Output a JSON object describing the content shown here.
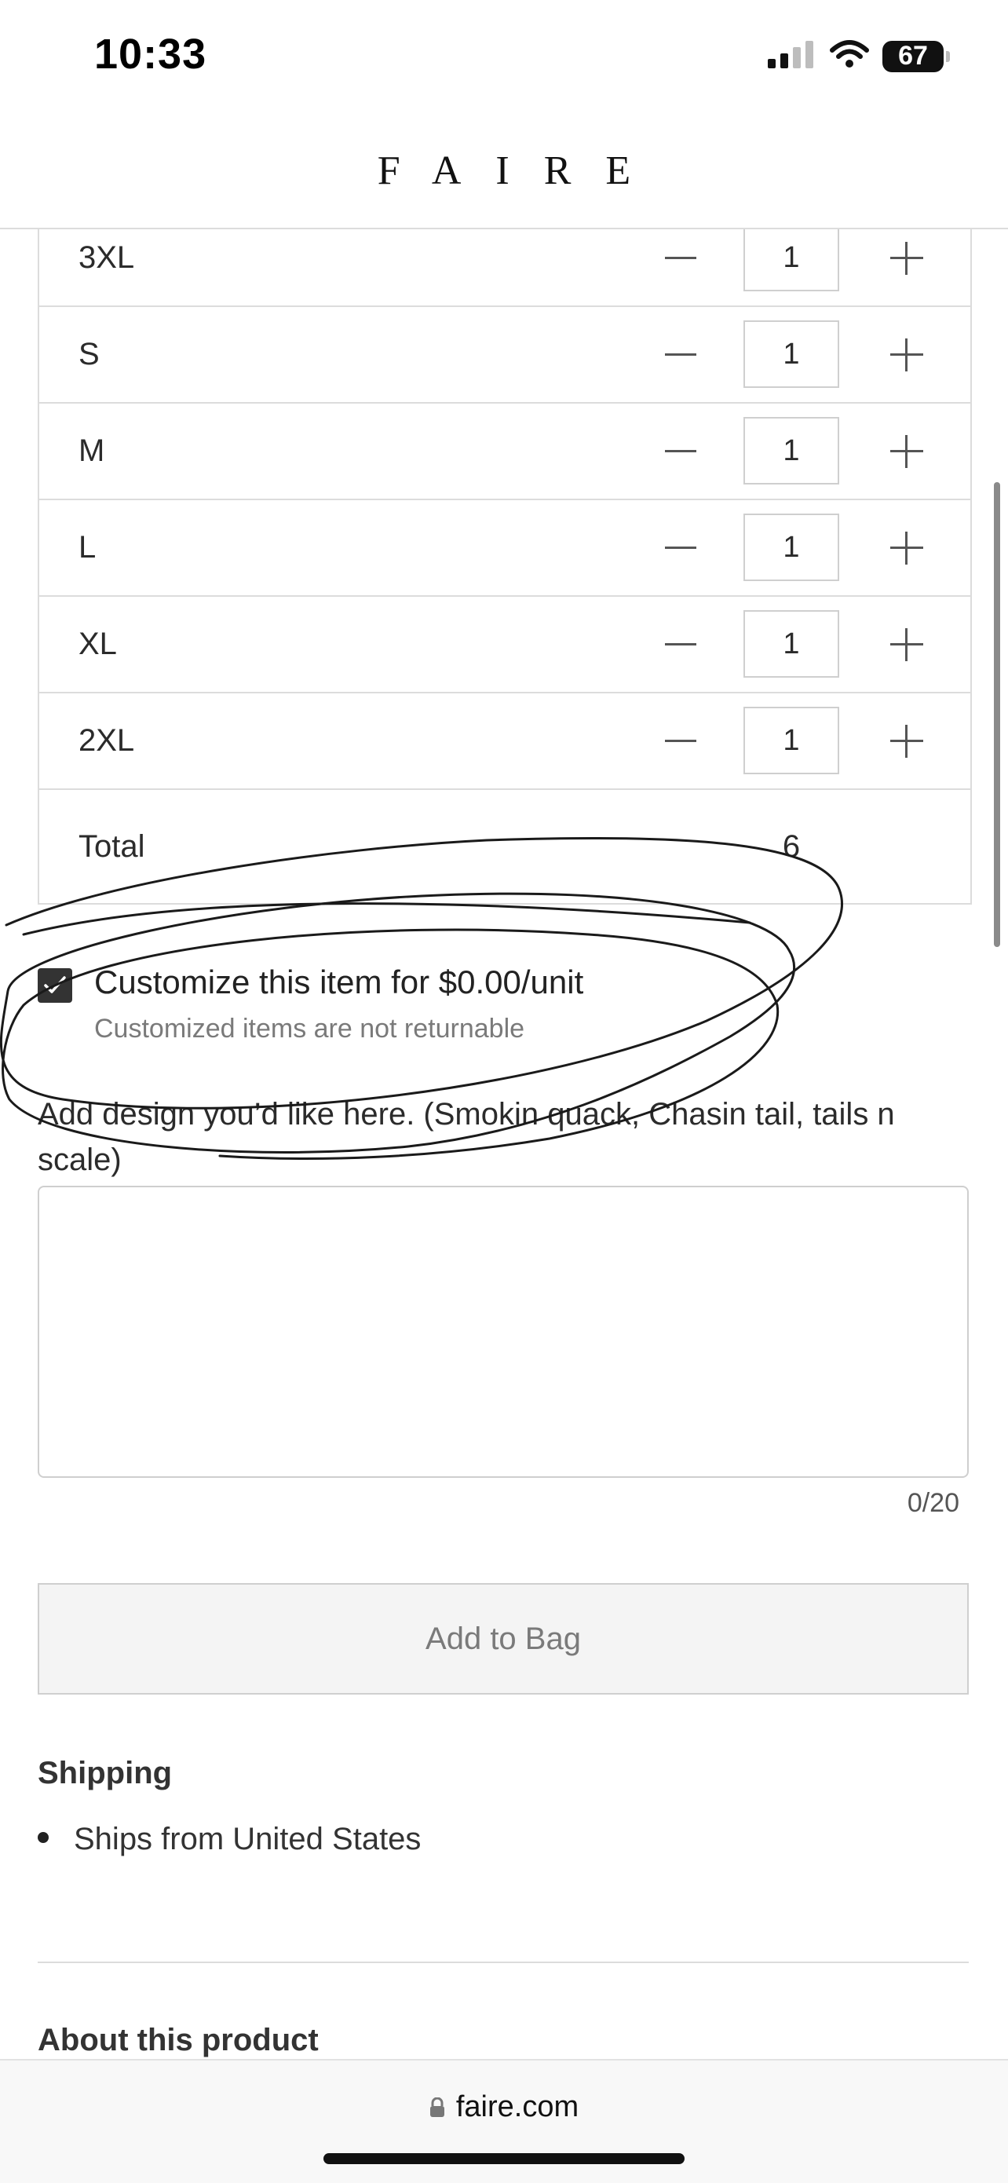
{
  "status_bar": {
    "time": "10:33",
    "battery": "67"
  },
  "header": {
    "brand": "FAIRE"
  },
  "sizes": [
    {
      "size": "3XL",
      "qty": "1"
    },
    {
      "size": "S",
      "qty": "1"
    },
    {
      "size": "M",
      "qty": "1"
    },
    {
      "size": "L",
      "qty": "1"
    },
    {
      "size": "XL",
      "qty": "1"
    },
    {
      "size": "2XL",
      "qty": "1"
    }
  ],
  "total": {
    "label": "Total",
    "value": "6"
  },
  "customize": {
    "checked": true,
    "label": "Customize this item for $0.00/unit",
    "note": "Customized items are not returnable"
  },
  "design": {
    "label": "Add design you’d like here. (Smokin quack, Chasin tail, tails n scale)",
    "value": "",
    "char_count": "0/20"
  },
  "add_to_bag": {
    "label": "Add to Bag"
  },
  "shipping": {
    "heading": "Shipping",
    "items": [
      "Ships from United States"
    ]
  },
  "about": {
    "heading": "About this product"
  },
  "browser": {
    "url": "faire.com"
  },
  "colors": {
    "border": "#dcdcdc",
    "checkbox": "#333333",
    "muted_text": "#7a7a7a",
    "button_bg": "#f4f4f4"
  }
}
